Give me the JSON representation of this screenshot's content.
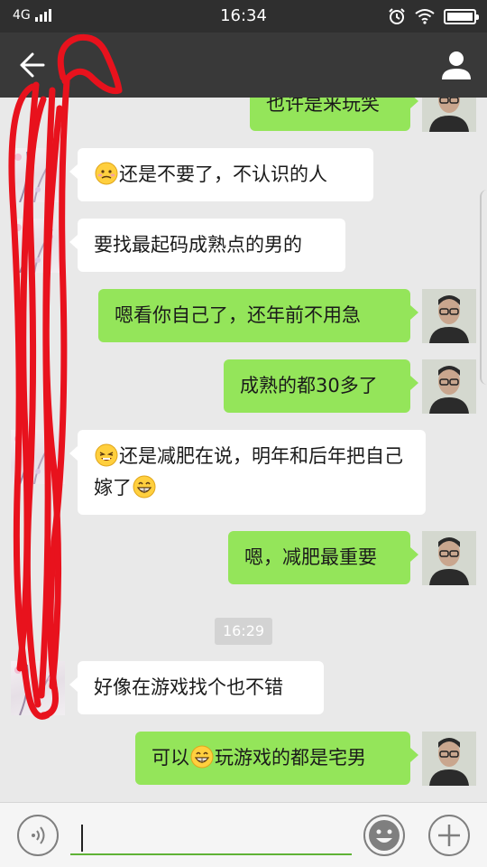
{
  "status_bar": {
    "network": "4G",
    "time": "16:34",
    "icons": [
      "alarm-icon",
      "wifi-icon",
      "battery-icon"
    ]
  },
  "nav": {
    "title": "",
    "back_icon": "arrow-left-icon",
    "profile_icon": "person-icon"
  },
  "colors": {
    "outgoing_bubble": "#94e55a",
    "incoming_bubble": "#ffffff",
    "chat_background": "#e9e9e9",
    "nav_bar": "#393939",
    "scribble": "#e8121d"
  },
  "messages": [
    {
      "direction": "out",
      "text": "也许是来玩笑"
    },
    {
      "direction": "in",
      "emoji_before": "awkward-face-emoji",
      "text": "还是不要了，不认识的人"
    },
    {
      "direction": "in",
      "text": "要找最起码成熟点的男的"
    },
    {
      "direction": "out",
      "text": "嗯看你自己了，还年前不用急"
    },
    {
      "direction": "out",
      "text": "成熟的都30多了"
    },
    {
      "direction": "in",
      "emoji_before": "tired-face-emoji",
      "text": "还是减肥在说，明年和后年把自己嫁了",
      "emoji_after": "grin-emoji"
    },
    {
      "direction": "out",
      "text": "嗯，减肥最重要"
    },
    {
      "direction": "in",
      "text": "好像在游戏找个也不错"
    },
    {
      "direction": "out",
      "text_before": "可以",
      "emoji": "grin-emoji",
      "text_after": "玩游戏的都是宅男"
    }
  ],
  "time_divider": "16:29",
  "input_bar": {
    "voice_icon": "voice-icon",
    "input_value": "",
    "emoji_icon": "smiley-icon",
    "plus_icon": "plus-icon"
  }
}
